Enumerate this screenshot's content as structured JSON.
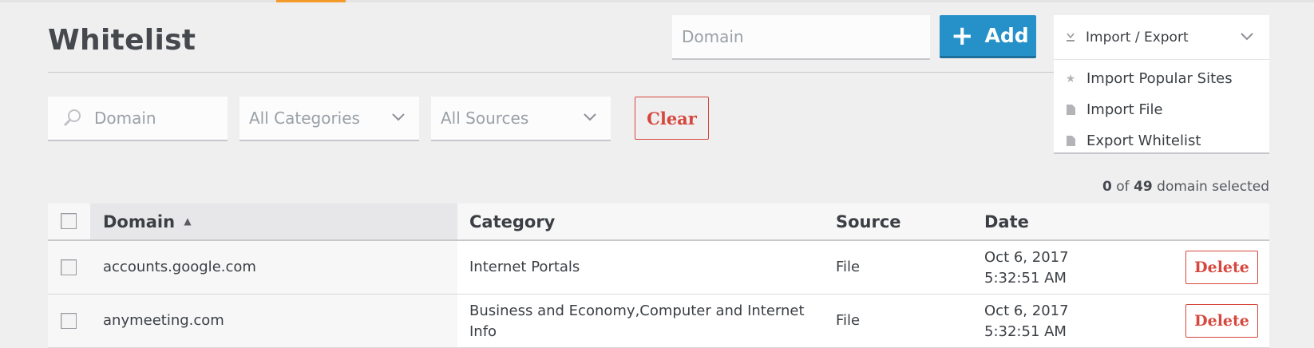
{
  "page": {
    "title": "Whitelist"
  },
  "add_domain": {
    "placeholder": "Domain",
    "button_label": "Add"
  },
  "import_export": {
    "label": "Import / Export",
    "menu": [
      {
        "label": "Import Popular Sites",
        "icon": "star-icon"
      },
      {
        "label": "Import File",
        "icon": "file-icon"
      },
      {
        "label": "Export Whitelist",
        "icon": "file-icon"
      }
    ]
  },
  "filters": {
    "search_placeholder": "Domain",
    "category_value": "All Categories",
    "source_value": "All Sources",
    "clear_label": "Clear"
  },
  "selection": {
    "selected": "0",
    "of_text": "of",
    "total": "49",
    "suffix": "domain selected"
  },
  "table": {
    "columns": [
      "Domain",
      "Category",
      "Source",
      "Date"
    ],
    "sorted_column": "Domain",
    "rows": [
      {
        "domain": "accounts.google.com",
        "category": "Internet Portals",
        "source": "File",
        "date_line1": "Oct 6, 2017",
        "date_line2": "5:32:51 AM",
        "action": "Delete"
      },
      {
        "domain": "anymeeting.com",
        "category": "Business and Economy,Computer and Internet Info",
        "source": "File",
        "date_line1": "Oct 6, 2017",
        "date_line2": "5:32:51 AM",
        "action": "Delete"
      }
    ]
  },
  "colors": {
    "accent_blue": "#2690c8",
    "danger_red": "#d6473d",
    "tab_orange": "#f39a2b"
  }
}
